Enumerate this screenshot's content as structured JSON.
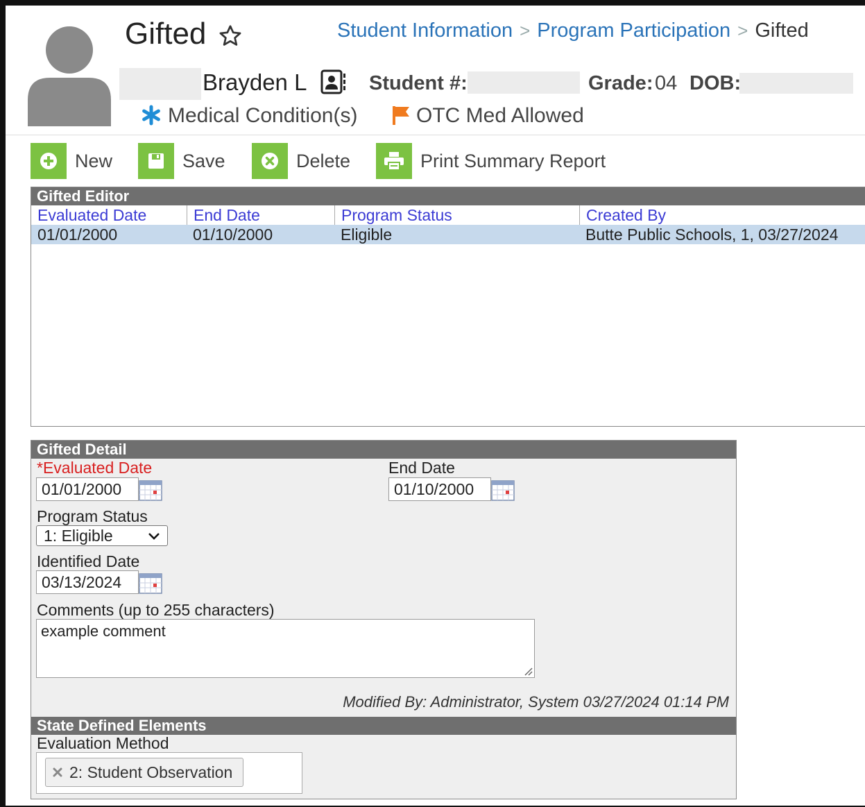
{
  "header": {
    "title": "Gifted",
    "breadcrumb": [
      "Student Information",
      "Program Participation",
      "Gifted"
    ],
    "student_name": "Brayden L",
    "student_number_label": "Student #:",
    "grade_label": "Grade:",
    "grade_value": "04",
    "dob_label": "DOB:",
    "medical_condition": "Medical Condition(s)",
    "otc": "OTC Med Allowed",
    "medical_icon_color": "#1f8dd6",
    "otc_flag_color": "#f07b1f"
  },
  "toolbar": {
    "new_label": "New",
    "save_label": "Save",
    "delete_label": "Delete",
    "print_label": "Print Summary Report",
    "button_color": "#7cc242"
  },
  "editor": {
    "title": "Gifted Editor",
    "columns": [
      "Evaluated Date",
      "End Date",
      "Program Status",
      "Created By"
    ],
    "rows": [
      [
        "01/01/2000",
        "01/10/2000",
        "Eligible",
        "Butte Public Schools, 1, 03/27/2024"
      ]
    ]
  },
  "detail": {
    "title": "Gifted Detail",
    "evaluated_date_required": "*",
    "evaluated_date_label": "Evaluated Date",
    "evaluated_date_value": "01/01/2000",
    "end_date_label": "End Date",
    "end_date_value": "01/10/2000",
    "program_status_label": "Program Status",
    "program_status_value": "1: Eligible",
    "identified_date_label": "Identified Date",
    "identified_date_value": "03/13/2024",
    "comments_label": "Comments (up to 255 characters)",
    "comments_value": "example comment",
    "modified_by": "Modified By: Administrator, System 03/27/2024 01:14 PM"
  },
  "state": {
    "title": "State Defined Elements",
    "evaluation_method_label": "Evaluation Method",
    "evaluation_method_value": "2: Student Observation"
  }
}
